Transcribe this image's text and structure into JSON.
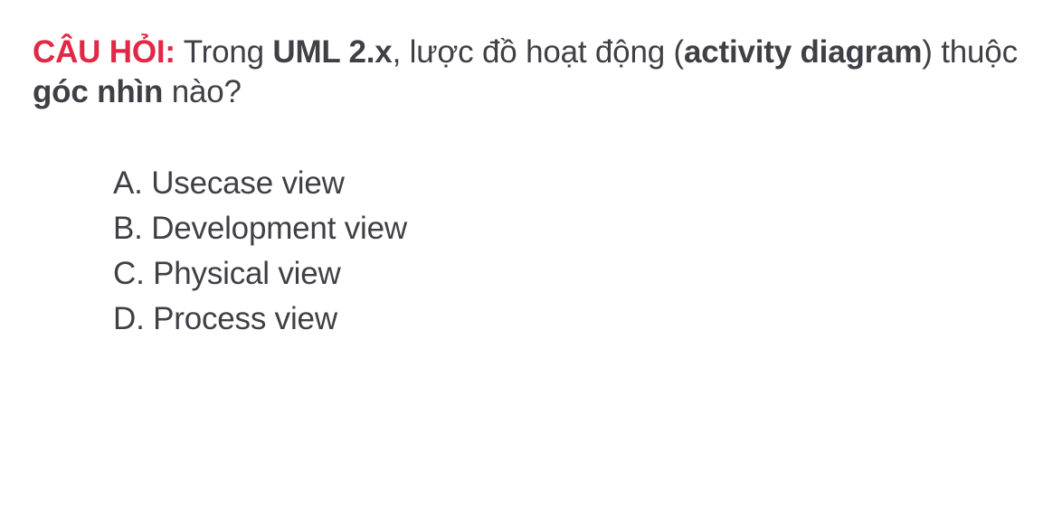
{
  "question": {
    "prefix": "CÂU HỎI:",
    "part1": " Trong ",
    "bold1": "UML 2.x",
    "part2": ", lược đồ hoạt động (",
    "bold2": "activity diagram",
    "part3": ") thuộc ",
    "bold3": "góc nhìn",
    "part4": " nào?"
  },
  "options": [
    {
      "label": "A. Usecase view"
    },
    {
      "label": "B. Development view"
    },
    {
      "label": "C. Physical view"
    },
    {
      "label": "D. Process view"
    }
  ],
  "colors": {
    "prefix": "#e02945",
    "text": "#3f3f46",
    "background": "#ffffff"
  }
}
